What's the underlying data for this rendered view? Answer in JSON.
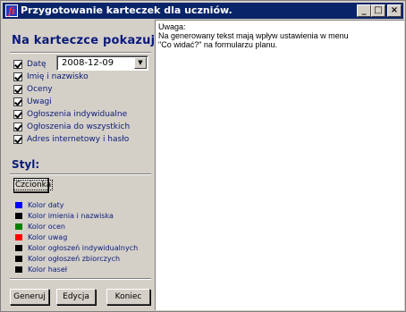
{
  "window": {
    "title": "Przygotowanie karteczek dla uczniów.",
    "app_icon": "fi",
    "minimize": "_",
    "maximize": "□",
    "close": "×"
  },
  "show_section": {
    "heading": "Na karteczce pokazuj:",
    "date_label": "Datę",
    "date_value": "2008-12-09",
    "options": [
      {
        "label": "Imię i nazwisko",
        "checked": true
      },
      {
        "label": "Oceny",
        "checked": true
      },
      {
        "label": "Uwagi",
        "checked": true
      },
      {
        "label": "Ogłoszenia indywidualne",
        "checked": true
      },
      {
        "label": "Ogłoszenia do wszystkich",
        "checked": true
      },
      {
        "label": "Adres internetowy i hasło",
        "checked": true
      }
    ]
  },
  "style_section": {
    "heading": "Styl:",
    "font_button": "Czcionka",
    "colors": [
      {
        "label": "Kolor daty",
        "color": "#0000ff"
      },
      {
        "label": "Kolor imienia i nazwiska",
        "color": "#000000"
      },
      {
        "label": "Kolor ocen",
        "color": "#008000"
      },
      {
        "label": "Kolor uwag",
        "color": "#ff0000"
      },
      {
        "label": "Kolor ogłoszeń indywidualnych",
        "color": "#000000"
      },
      {
        "label": "Kolor ogłoszeń zbiorczych",
        "color": "#000000"
      },
      {
        "label": "Kolor haseł",
        "color": "#000000"
      }
    ]
  },
  "buttons": {
    "generate": "Generuj",
    "edit": "Edycja",
    "exit": "Koniec"
  },
  "preview": {
    "lines": [
      "Uwaga:",
      "Na generowany tekst mają wpływ ustawienia w menu",
      "\"Co widać?\" na formularzu planu."
    ]
  }
}
